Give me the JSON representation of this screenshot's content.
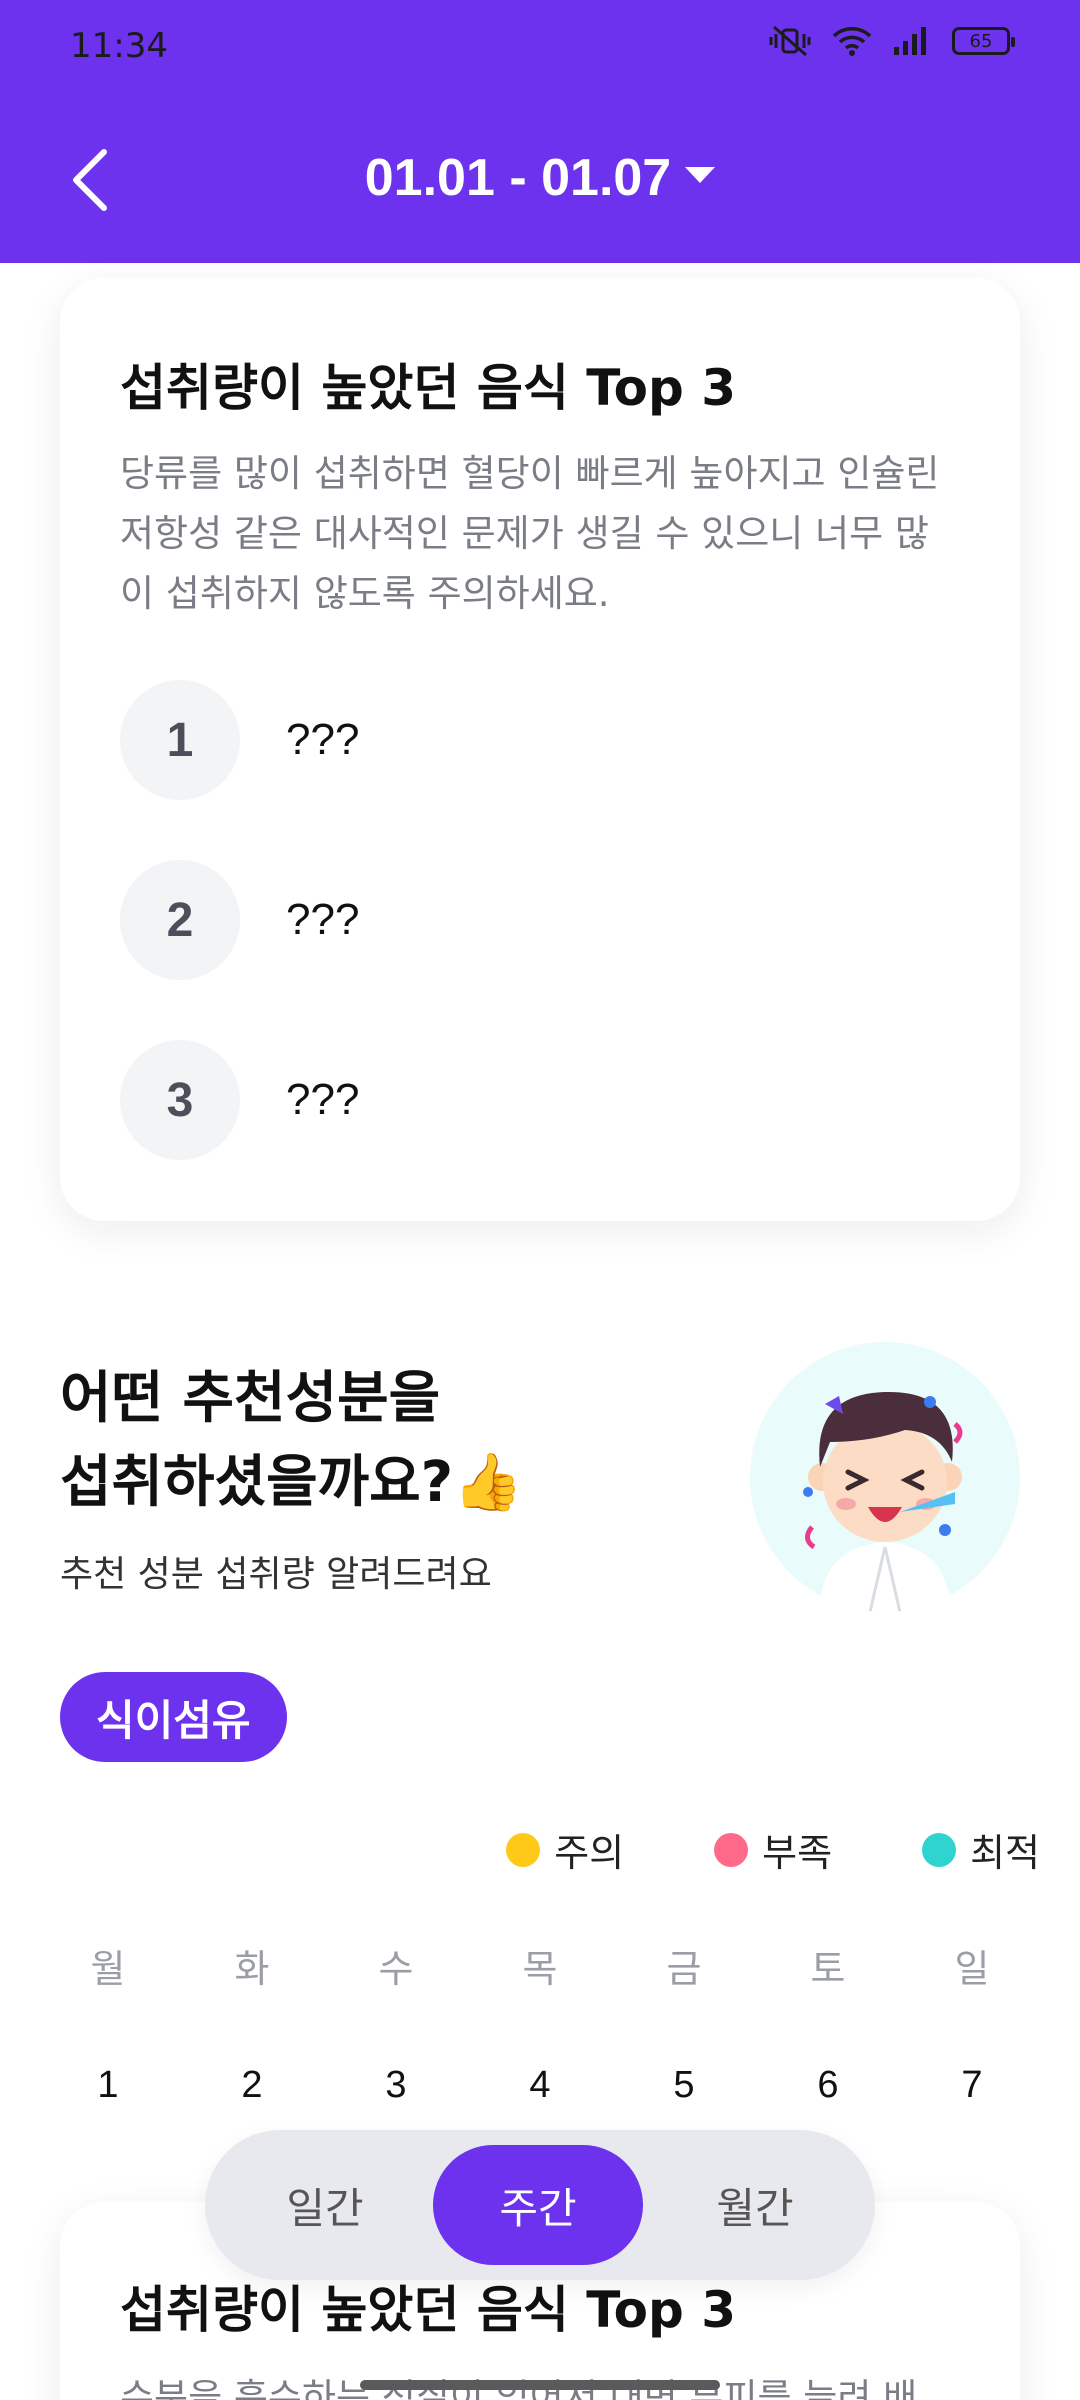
{
  "status_bar": {
    "time": "11:34",
    "battery": "65"
  },
  "header": {
    "date_range": "01.01 - 01.07"
  },
  "top_card": {
    "title": "섭취량이 높았던 음식 Top 3",
    "description": "당류를 많이 섭취하면 혈당이 빠르게 높아지고 인슐린 저항성 같은 대사적인 문제가 생길 수 있으니 너무 많이 섭취하지 않도록 주의하세요.",
    "items": [
      {
        "rank": "1",
        "name": "???"
      },
      {
        "rank": "2",
        "name": "???"
      },
      {
        "rank": "3",
        "name": "???"
      }
    ]
  },
  "recommendation": {
    "title_line1": "어떤 추천성분을",
    "title_line2": "섭취하셨을까요?",
    "title_emoji": "👍",
    "subtitle": "추천 성분 섭취량 알려드려요",
    "nutrient_chip": "식이섬유"
  },
  "legend": [
    {
      "label": "주의",
      "color": "#FFC91A"
    },
    {
      "label": "부족",
      "color": "#FF6A8A"
    },
    {
      "label": "최적",
      "color": "#2FD3CF"
    }
  ],
  "week": {
    "days": [
      "월",
      "화",
      "수",
      "목",
      "금",
      "토",
      "일"
    ],
    "dates": [
      "1",
      "2",
      "3",
      "4",
      "5",
      "6",
      "7"
    ]
  },
  "bottom_card": {
    "title": "섭취량이 높았던 음식 Top 3",
    "description": "수분을 흡수하는 성질이 있어서 대변 부피를 늘려 배"
  },
  "period_tabs": {
    "daily": "일간",
    "weekly": "주간",
    "monthly": "월간",
    "selected": "주간"
  },
  "colors": {
    "primary": "#6D32EE"
  }
}
